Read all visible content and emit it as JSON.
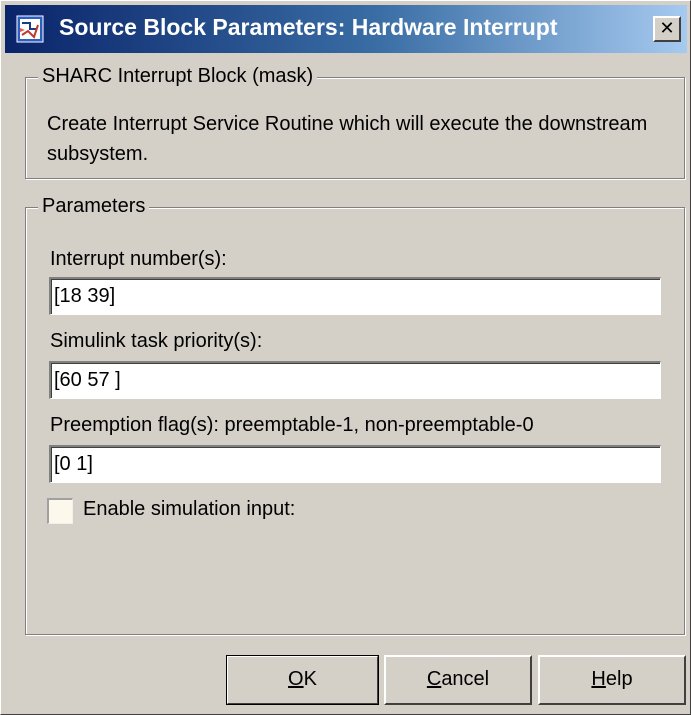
{
  "window": {
    "title": "Source Block Parameters: Hardware Interrupt",
    "close_glyph": "✕"
  },
  "mask_group": {
    "legend": "SHARC Interrupt Block (mask)",
    "description": "Create Interrupt Service Routine which will execute the downstream subsystem."
  },
  "params_group": {
    "legend": "Parameters",
    "fields": [
      {
        "label": "Interrupt number(s):",
        "value": "[18 39]"
      },
      {
        "label": "Simulink task priority(s):",
        "value": "[60 57 ]"
      },
      {
        "label": "Preemption flag(s): preemptable-1, non-preemptable-0",
        "value": "[0 1]"
      }
    ],
    "checkbox": {
      "label": "Enable simulation input:",
      "checked": false
    }
  },
  "buttons": {
    "ok": {
      "mnemonic": "O",
      "rest": "K"
    },
    "cancel": {
      "mnemonic": "C",
      "rest": "ancel"
    },
    "help": {
      "mnemonic": "H",
      "rest": "elp"
    }
  },
  "colors": {
    "titlebar_start": "#0a246a",
    "titlebar_end": "#a6caf0",
    "dialog_bg": "#d4d0c8"
  },
  "icons": {
    "app_icon": "simulink-block-icon",
    "close": "close-icon"
  }
}
